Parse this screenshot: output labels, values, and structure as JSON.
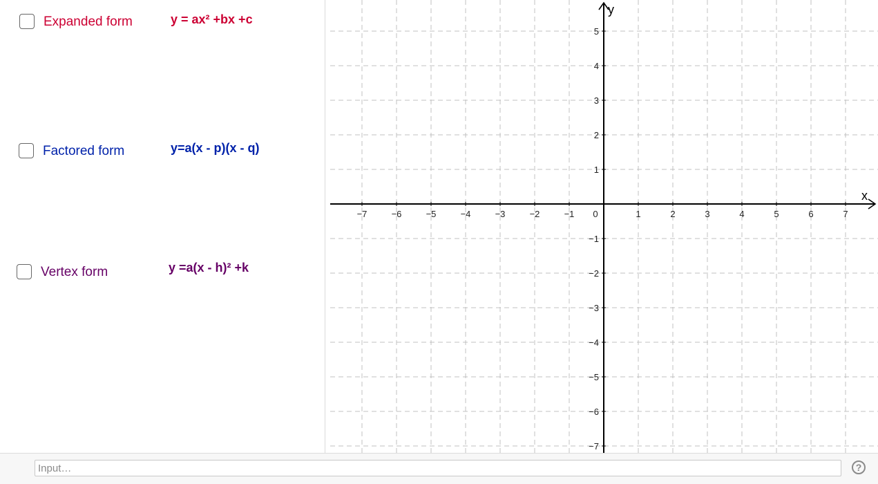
{
  "forms": [
    {
      "label": "Expanded form",
      "formula": "y = ax² +bx +c",
      "color": "#cc0033",
      "checked": false
    },
    {
      "label": "Factored form",
      "formula": "y=a(x - p)(x - q)",
      "color": "#0022aa",
      "checked": false
    },
    {
      "label": "Vertex form",
      "formula": "y =a(x - h)² +k",
      "color": "#660066",
      "checked": false
    }
  ],
  "graph": {
    "x_axis_label": "x",
    "y_axis_label": "y",
    "x_ticks": [
      "−7",
      "−6",
      "−5",
      "−4",
      "−3",
      "−2",
      "−1",
      "0",
      "1",
      "2",
      "3",
      "4",
      "5",
      "6",
      "7"
    ],
    "y_ticks": [
      "5",
      "4",
      "3",
      "2",
      "1",
      "−1",
      "−2",
      "−3",
      "−4",
      "−5",
      "−6",
      "−7"
    ],
    "x_range": [
      -7.9,
      7.9
    ],
    "y_range": [
      -7.2,
      5.9
    ],
    "grid": true,
    "grid_color": "#c0c0c0"
  },
  "input_bar": {
    "placeholder": "Input…"
  },
  "help": {
    "symbol": "?"
  }
}
